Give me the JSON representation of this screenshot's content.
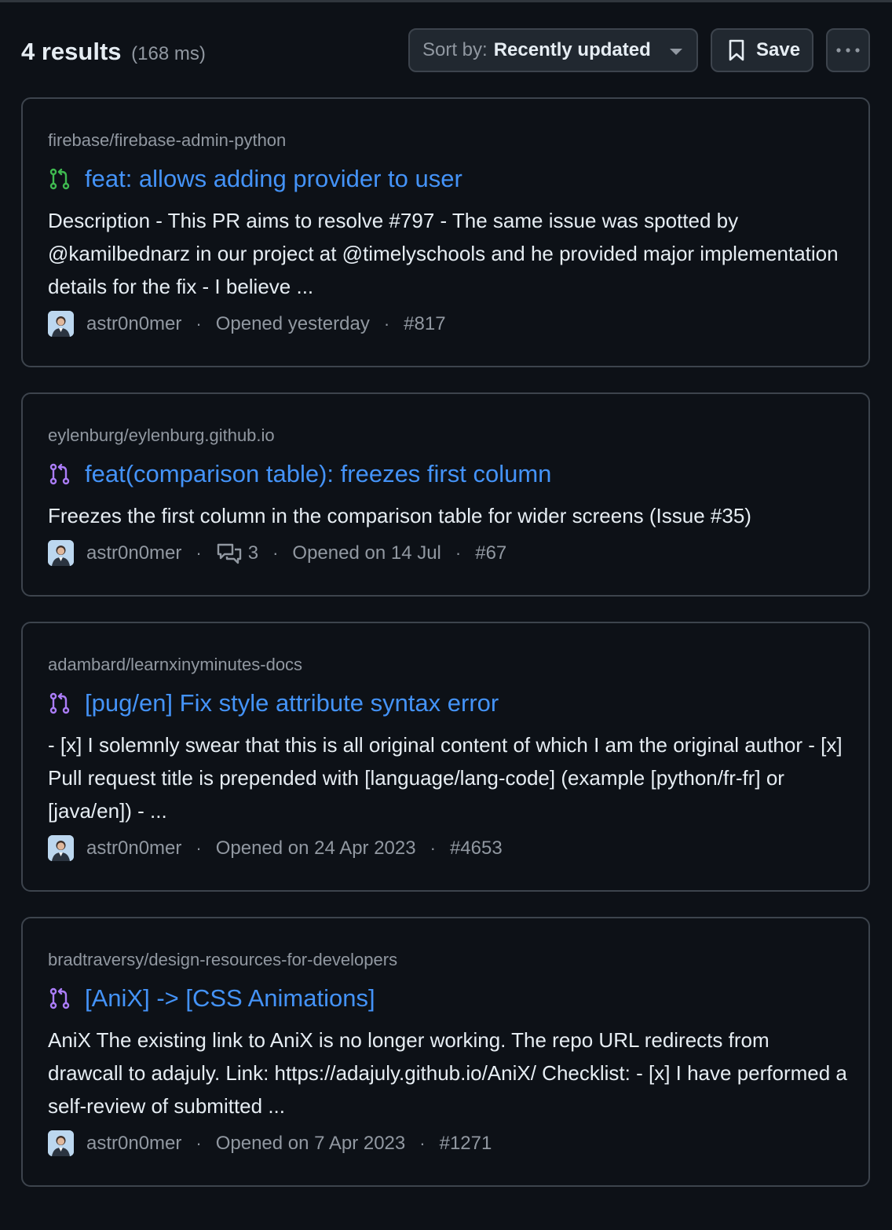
{
  "header": {
    "result_count": "4 results",
    "timing": "(168 ms)",
    "sort_prefix": "Sort by:",
    "sort_value": "Recently updated",
    "save_label": "Save"
  },
  "colors": {
    "open_pr": "#3fb950",
    "merged_pr": "#ab7df8",
    "link": "#4493f8"
  },
  "results": [
    {
      "repo": "firebase/firebase-admin-python",
      "title": "feat: allows adding provider to user",
      "state": "open",
      "description": "Description - This PR aims to resolve #797 - The same issue was spotted by @kamilbednarz in our project at @timelyschools and he provided major implementation details for the fix - I believe ...",
      "author": "astr0n0mer",
      "opened": "Opened yesterday",
      "number": "#817"
    },
    {
      "repo": "eylenburg/eylenburg.github.io",
      "title": "feat(comparison table): freezes first column",
      "state": "merged",
      "description": "Freezes the first column in the comparison table for wider screens (Issue #35)",
      "author": "astr0n0mer",
      "comments": "3",
      "opened": "Opened on 14 Jul",
      "number": "#67"
    },
    {
      "repo": "adambard/learnxinyminutes-docs",
      "title": "[pug/en] Fix style attribute syntax error",
      "state": "merged",
      "description": "- [x] I solemnly swear that this is all original content of which I am the original author - [x] Pull request title is prepended with [language/lang-code] (example [python/fr-fr] or [java/en]) - ...",
      "author": "astr0n0mer",
      "opened": "Opened on 24 Apr 2023",
      "number": "#4653"
    },
    {
      "repo": "bradtraversy/design-resources-for-developers",
      "title": "[AniX] -> [CSS Animations]",
      "state": "merged",
      "description": "AniX The existing link to AniX is no longer working. The repo URL redirects from drawcall to adajuly. Link: https://adajuly.github.io/AniX/ Checklist: - [x] I have performed a self-review of submitted ...",
      "author": "astr0n0mer",
      "opened": "Opened on 7 Apr 2023",
      "number": "#1271"
    }
  ]
}
